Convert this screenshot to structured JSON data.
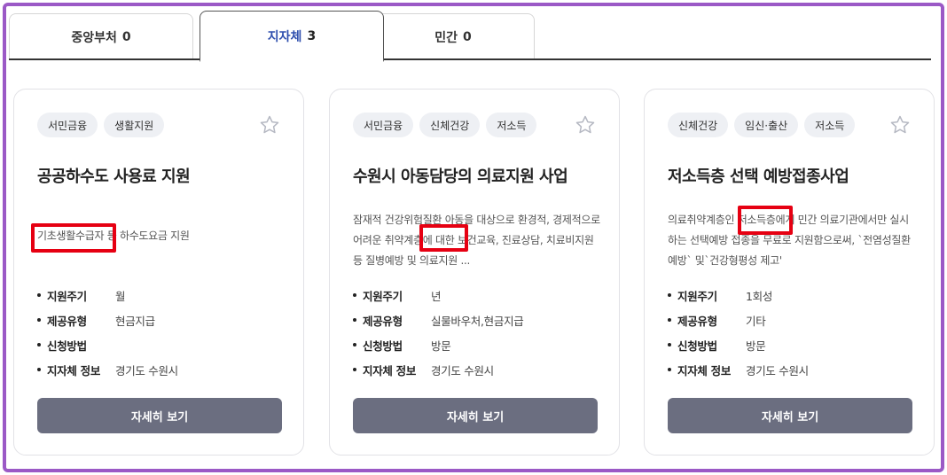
{
  "tabs": [
    {
      "label": "중앙부처",
      "count": "0",
      "active": false
    },
    {
      "label": "지자체",
      "count": "3",
      "active": true
    },
    {
      "label": "민간",
      "count": "0",
      "active": false
    }
  ],
  "cards": [
    {
      "tags": [
        "서민금융",
        "생활지원"
      ],
      "title": "공공하수도 사용료 지원",
      "description": "기초생활수급자 등 하수도요금 지원",
      "info": [
        {
          "key": "지원주기",
          "value": "월"
        },
        {
          "key": "제공유형",
          "value": "현금지급"
        },
        {
          "key": "신청방법",
          "value": ""
        },
        {
          "key": "지자체 정보",
          "value": "경기도 수원시"
        }
      ],
      "button": "자세히 보기"
    },
    {
      "tags": [
        "서민금융",
        "신체건강",
        "저소득"
      ],
      "title": "수원시 아동담당의 의료지원 사업",
      "description": "잠재적 건강위험질환 아동을 대상으로 환경적, 경제적으로 어려운 취약계층에 대한 보건교육, 진료상담, 치료비지원 등 질병예방 및 의료지원 ...",
      "info": [
        {
          "key": "지원주기",
          "value": "년"
        },
        {
          "key": "제공유형",
          "value": "실물바우처,현금지급"
        },
        {
          "key": "신청방법",
          "value": "방문"
        },
        {
          "key": "지자체 정보",
          "value": "경기도 수원시"
        }
      ],
      "button": "자세히 보기"
    },
    {
      "tags": [
        "신체건강",
        "임신·출산",
        "저소득"
      ],
      "title": "저소득층 선택 예방접종사업",
      "description": "의료취약계층인 저소득층에게 민간 의료기관에서만 실시하는 선택예방 접종을 무료로 지원함으로써, `전염성질환 예방` 및`건강형평성 제고'",
      "info": [
        {
          "key": "지원주기",
          "value": "1회성"
        },
        {
          "key": "제공유형",
          "value": "기타"
        },
        {
          "key": "신청방법",
          "value": "방문"
        },
        {
          "key": "지자체 정보",
          "value": "경기도 수원시"
        }
      ],
      "button": "자세히 보기"
    }
  ],
  "icons": {
    "favorite": "star-outline-icon"
  },
  "colors": {
    "frame": "#9b59c6",
    "active_tab": "#2f4fae",
    "button": "#6b6e80",
    "highlight": "#e60012"
  }
}
